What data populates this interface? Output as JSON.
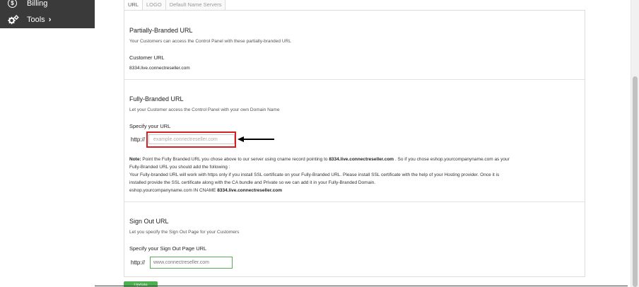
{
  "sidebar": {
    "items": [
      {
        "label": "Billing",
        "icon": "dollar-circle-icon"
      },
      {
        "label": "Tools",
        "icon": "gears-icon"
      }
    ]
  },
  "tabs": [
    "URL",
    "LOGO",
    "Default Name Servers"
  ],
  "partial": {
    "title": "Partially-Branded URL",
    "description": "Your Customers can access the Control Panel with these partially-branded URL",
    "customer_url_label": "Customer URL",
    "customer_url_value": "8334.live.connectreseller.com"
  },
  "fully": {
    "title": "Fully-Branded URL",
    "description": "Let your Customer access the Control Panel with your own Domain Name",
    "specify_label": "Specify your URL",
    "prefix": "http://",
    "placeholder": "example.connectreseller.com",
    "note_label": "Note:",
    "note_text1a": "Point the Fully Branded URL you chose above to our server using cname record pointing to ",
    "note_host": "8334.live.connectreseller.com",
    "note_text1b": " . So if you chose eshop.yourcompanyname.com as your",
    "note_text2": "Fully-Branded URL you should add the following :",
    "note_text3": "Your Fully-branded URL will work with https only if you install SSL certificate on your Fully-Branded URL. Please install SSL certificate with the help of your Hosting provider. Once it is",
    "note_text4": "installed provide the SSL certificate along with the CA bundle and Private so we can add it in your Fully-Branded Domain.",
    "note_text5a": "eshop.yourcompanyname.com IN CNAME ",
    "note_text5b": "8334.live.connectreseller.com"
  },
  "signout": {
    "title": "Sign Out URL",
    "description": "Let you specify the Sign Out Page for your Customers",
    "specify_label": "Specify your Sign Out Page URL",
    "prefix": "http://",
    "value": "www.connectreseller.com"
  },
  "update_button": "Update",
  "colors": {
    "sidebar_bg": "#3a3a3a",
    "highlight": "#d42020",
    "update_green": "#4caf50"
  }
}
